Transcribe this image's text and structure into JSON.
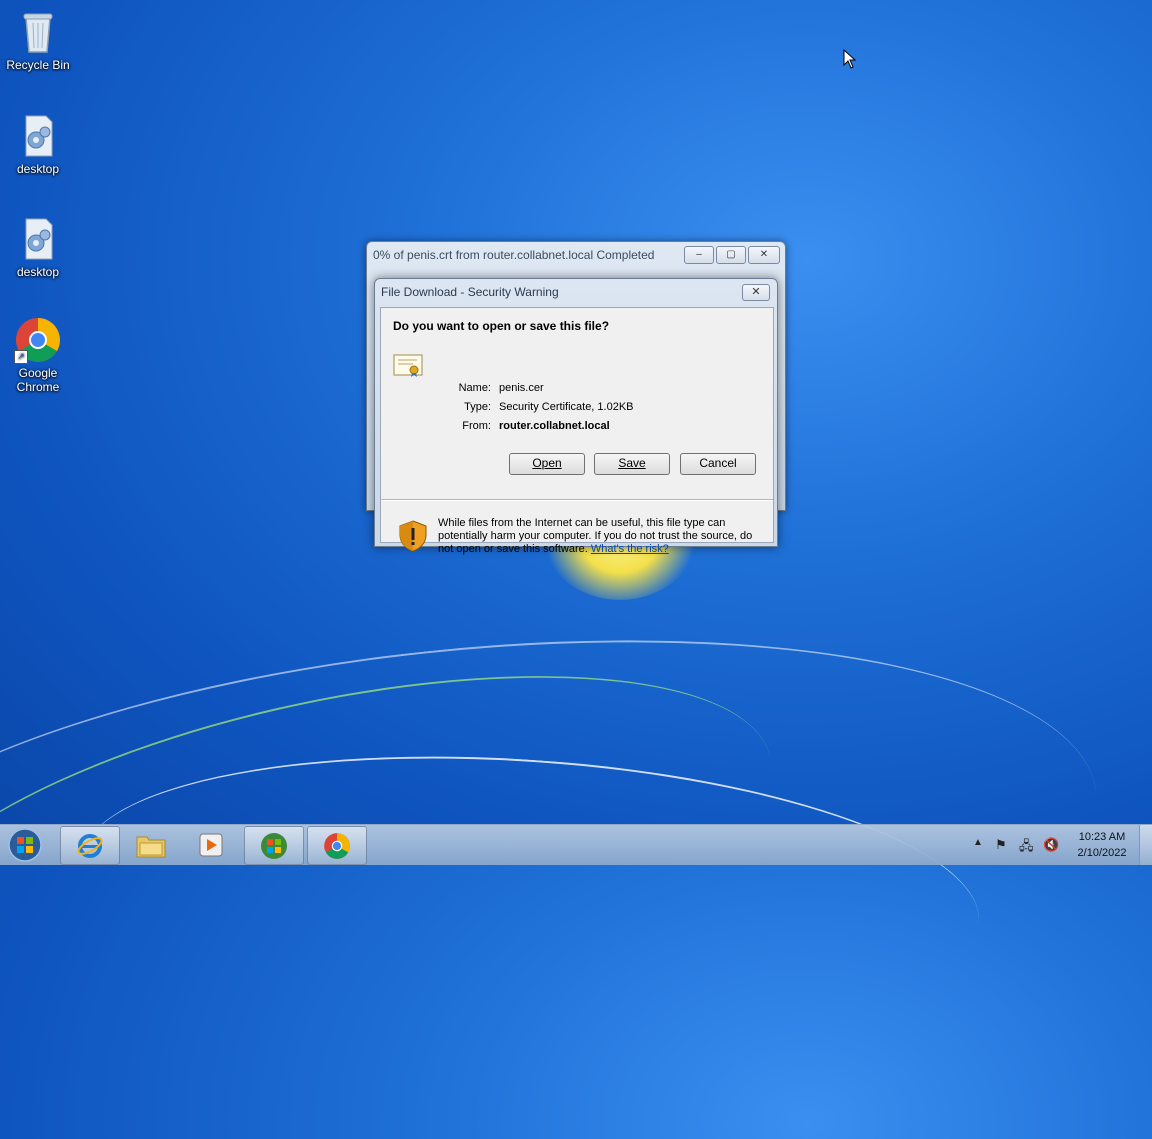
{
  "desktop": {
    "icons": [
      {
        "label": "Recycle Bin",
        "icon": "recycle-bin-icon"
      },
      {
        "label": "desktop",
        "icon": "config-file-icon"
      },
      {
        "label": "desktop",
        "icon": "config-file-icon"
      },
      {
        "label": "Google Chrome",
        "icon": "chrome-icon"
      }
    ]
  },
  "progress_window": {
    "title": "0% of penis.crt from router.collabnet.local Completed",
    "minimize": "–",
    "maximize": "▢",
    "close": "✕"
  },
  "dialog": {
    "title": "File Download - Security Warning",
    "close": "✕",
    "question": "Do you want to open or save this file?",
    "fields": [
      {
        "label": "Name:",
        "value": "penis.cer"
      },
      {
        "label": "Type:",
        "value": "Security Certificate, 1.02KB"
      },
      {
        "label": "From:",
        "value": "router.collabnet.local"
      }
    ],
    "buttons": {
      "open": "Open",
      "save": "Save",
      "cancel": "Cancel"
    },
    "warning_text": "While files from the Internet can be useful, this file type can potentially harm your computer. If you do not trust the source, do not open or save this software.",
    "risk_link": "What's the risk?"
  },
  "taskbar": {
    "apps": [
      "internet-explorer-icon",
      "file-explorer-icon",
      "media-player-icon",
      "windows-logo-icon",
      "chrome-icon"
    ],
    "clock_time": "10:23 AM",
    "clock_date": "2/10/2022"
  },
  "colors": {
    "desktop_blue": "#1e6fd6",
    "link": "#0645ad",
    "dialog_face": "#f0f0f0"
  }
}
